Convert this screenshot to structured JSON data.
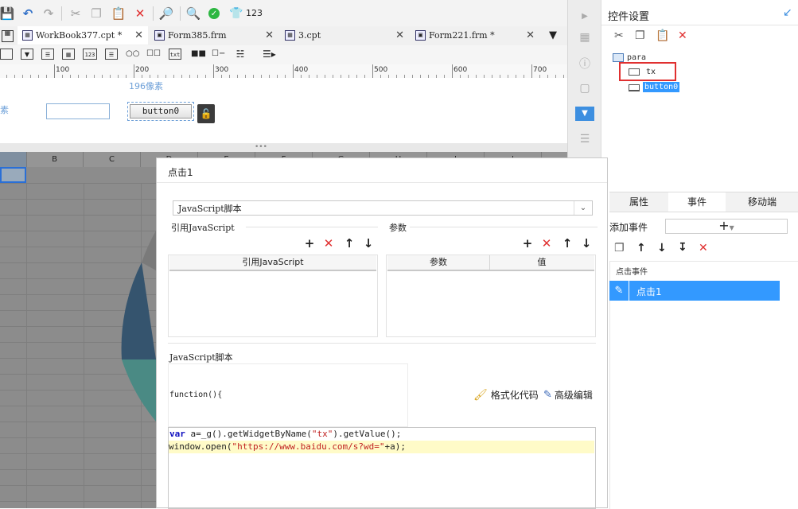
{
  "toolbar": {
    "version_text": "123"
  },
  "tabs": [
    {
      "label": "WorkBook377.cpt *"
    },
    {
      "label": "Form385.frm"
    },
    {
      "label": "3.cpt"
    },
    {
      "label": "Form221.frm *"
    }
  ],
  "widget_bar": {
    "items": [
      "123",
      "txt"
    ]
  },
  "ruler": {
    "labels": [
      "100",
      "200",
      "300",
      "400",
      "500",
      "600",
      "700"
    ]
  },
  "form_design": {
    "size_hint": "196像素",
    "left_fragment": "素",
    "button_label": "button0"
  },
  "sheet": {
    "columns": [
      "B",
      "C",
      "D",
      "E",
      "F",
      "G",
      "H",
      "I",
      "J"
    ]
  },
  "right_panel": {
    "title": "控件设置",
    "tree": {
      "root": "para",
      "child_tx": "tx",
      "child_button": "button0"
    },
    "tabs": [
      "属性",
      "事件",
      "移动端"
    ],
    "add_event_label": "添加事件",
    "event_group": "点击事件",
    "event_item": "点击1"
  },
  "dialog": {
    "title": "点击1",
    "type_select": "JavaScript脚本",
    "ref_js_label": "引用JavaScript",
    "params_label": "参数",
    "ref_table_header": "引用JavaScript",
    "params_headers": [
      "参数",
      "值"
    ],
    "script_label": "JavaScript脚本",
    "function_decl": "function(){",
    "format_code": "格式化代码",
    "advanced_edit": "高级编辑",
    "code_line1": "var a=_g().getWidgetByName(\"tx\").getValue();",
    "code_line2": "window.open(\"https://www.baidu.com/s?wd=\"+a);"
  },
  "colors": {
    "accent": "#3d8fe0",
    "selection": "#3399ff",
    "danger": "#e03030",
    "highlight_line": "#fffbc8"
  }
}
